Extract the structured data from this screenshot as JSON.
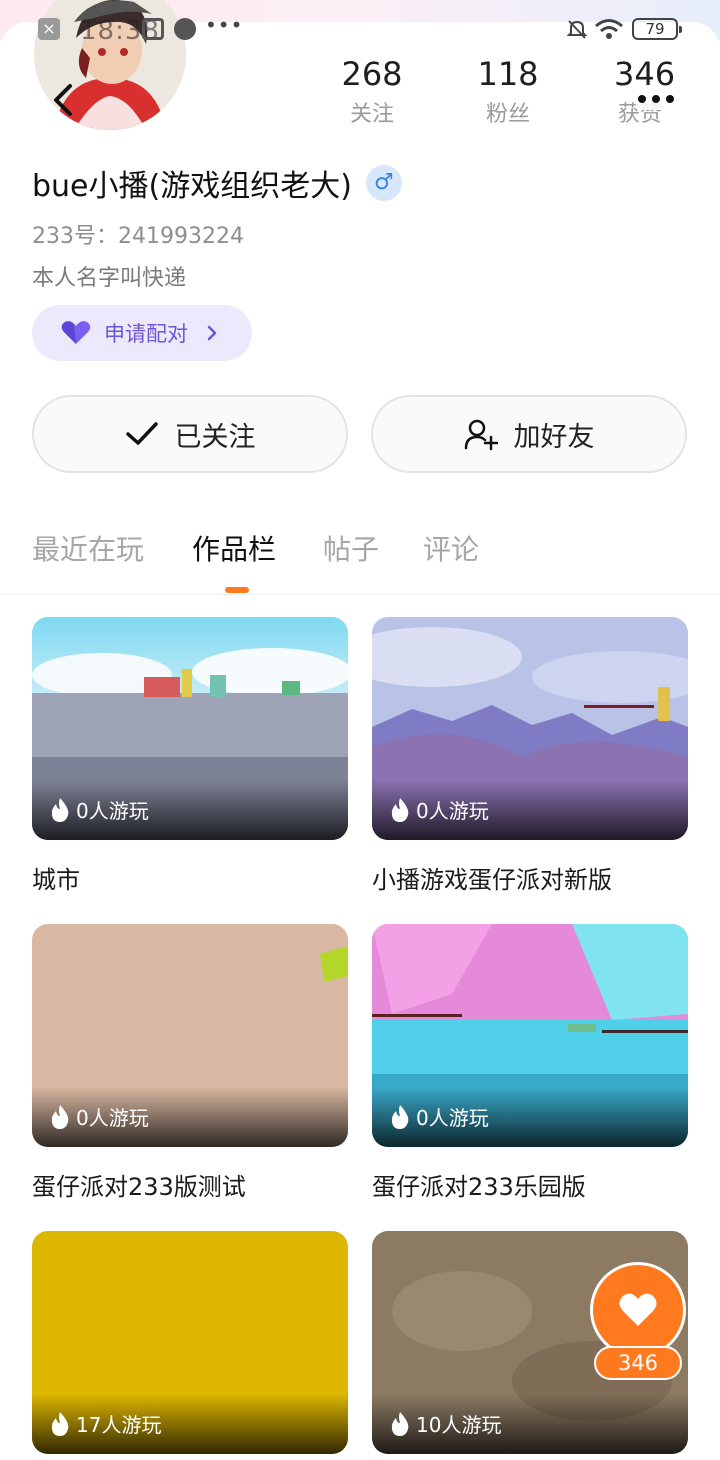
{
  "status_bar": {
    "time": "18:38",
    "battery": "79",
    "icons": [
      "close-notification-icon",
      "message-icon",
      "voice-icon",
      "more-dots-icon",
      "bell-muted-icon",
      "wifi-icon",
      "battery-icon"
    ]
  },
  "profile": {
    "username": "bue小播(游戏组织老大)",
    "gender_symbol": "♂",
    "uid": "233号：241993224",
    "bio": "本人名字叫快递",
    "match_label": "申请配对"
  },
  "stats": [
    {
      "value": "268",
      "label": "关注"
    },
    {
      "value": "118",
      "label": "粉丝"
    },
    {
      "value": "346",
      "label": "获赞"
    }
  ],
  "actions": {
    "followed_label": "已关注",
    "add_friend_label": "加好友"
  },
  "tabs": [
    {
      "label": "最近在玩",
      "active": false
    },
    {
      "label": "作品栏",
      "active": true
    },
    {
      "label": "帖子",
      "active": false
    },
    {
      "label": "评论",
      "active": false
    }
  ],
  "works": [
    {
      "title": "城市",
      "plays": "0人游玩"
    },
    {
      "title": "小播游戏蛋仔派对新版",
      "plays": "0人游玩"
    },
    {
      "title": "蛋仔派对233版测试",
      "plays": "0人游玩"
    },
    {
      "title": "蛋仔派对233乐园版",
      "plays": "0人游玩"
    },
    {
      "title": "",
      "plays": "17人游玩"
    },
    {
      "title": "",
      "plays": "10人游玩"
    }
  ],
  "like_button": {
    "count": "346"
  },
  "colors": {
    "accent": "#ff7a1f",
    "match_purple": "#6e56d8",
    "match_bg": "#ece9fc"
  }
}
